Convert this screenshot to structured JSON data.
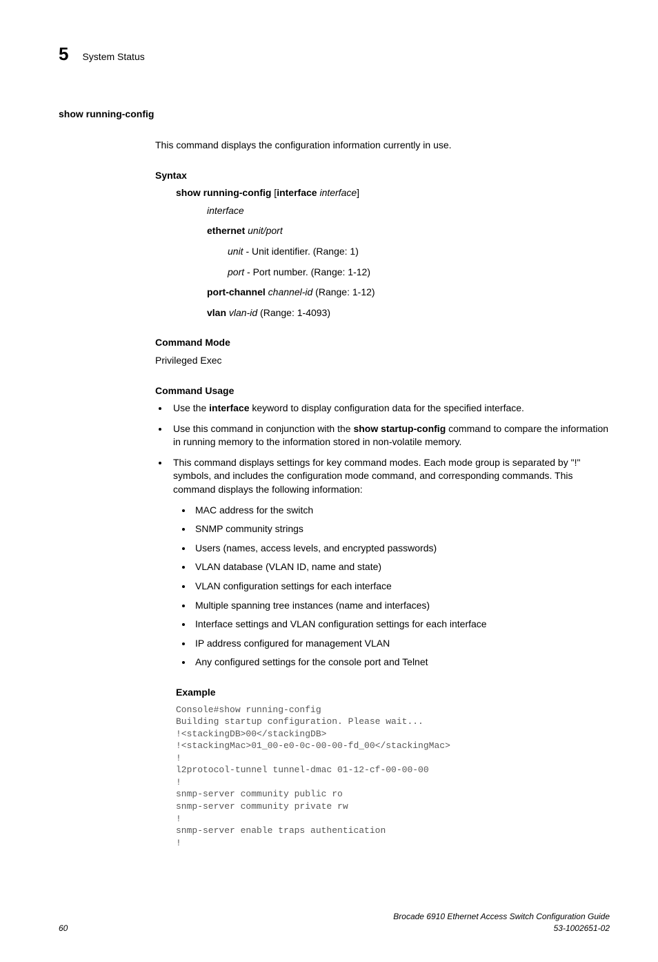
{
  "header": {
    "chapter_num": "5",
    "chapter_title": "System Status"
  },
  "command": {
    "name": "show running-config",
    "description": "This command displays the configuration information currently in use."
  },
  "syntax": {
    "heading": "Syntax",
    "cmd_bold1": "show running-config",
    "cmd_mid": " [",
    "cmd_bold2": "interface",
    "cmd_italic": " interface",
    "cmd_end": "]",
    "interface_label": "interface",
    "ethernet_bold": "ethernet",
    "ethernet_italic": " unit/port",
    "unit_italic": "unit",
    "unit_text": " - Unit identifier. (Range: 1)",
    "port_italic": "port",
    "port_text": " - Port number. (Range: 1-12)",
    "portchannel_bold": "port-channel",
    "portchannel_italic": " channel-id",
    "portchannel_text": " (Range: 1-12)",
    "vlan_bold": "vlan",
    "vlan_italic": " vlan-id",
    "vlan_text": " (Range: 1-4093)"
  },
  "command_mode": {
    "heading": "Command Mode",
    "text": "Privileged Exec"
  },
  "usage": {
    "heading": "Command Usage",
    "b1_pre": "Use the ",
    "b1_bold": "interface",
    "b1_post": " keyword to display configuration data for the specified interface.",
    "b2_pre": "Use this command in conjunction with the ",
    "b2_bold": "show startup-config",
    "b2_post": " command to compare the information in running memory to the information stored in non-volatile memory.",
    "b3": "This command displays settings for key command modes. Each mode group is separated by \"!\" symbols, and includes the configuration mode command, and corresponding commands. This command displays the following information:",
    "sub": [
      "MAC address for the switch",
      "SNMP community strings",
      "Users (names, access levels, and encrypted passwords)",
      "VLAN database (VLAN ID, name and state)",
      "VLAN configuration settings for each interface",
      "Multiple spanning tree instances (name and interfaces)",
      "Interface settings and VLAN configuration settings for each interface",
      "IP address configured for management VLAN",
      "Any configured settings for the console port and Telnet"
    ]
  },
  "example": {
    "heading": "Example",
    "code": "Console#show running-config\nBuilding startup configuration. Please wait...\n!<stackingDB>00</stackingDB>\n!<stackingMac>01_00-e0-0c-00-00-fd_00</stackingMac>\n!\nl2protocol-tunnel tunnel-dmac 01-12-cf-00-00-00\n!\nsnmp-server community public ro\nsnmp-server community private rw\n!\nsnmp-server enable traps authentication\n!"
  },
  "footer": {
    "page": "60",
    "title": "Brocade 6910 Ethernet Access Switch Configuration Guide",
    "docnum": "53-1002651-02"
  }
}
